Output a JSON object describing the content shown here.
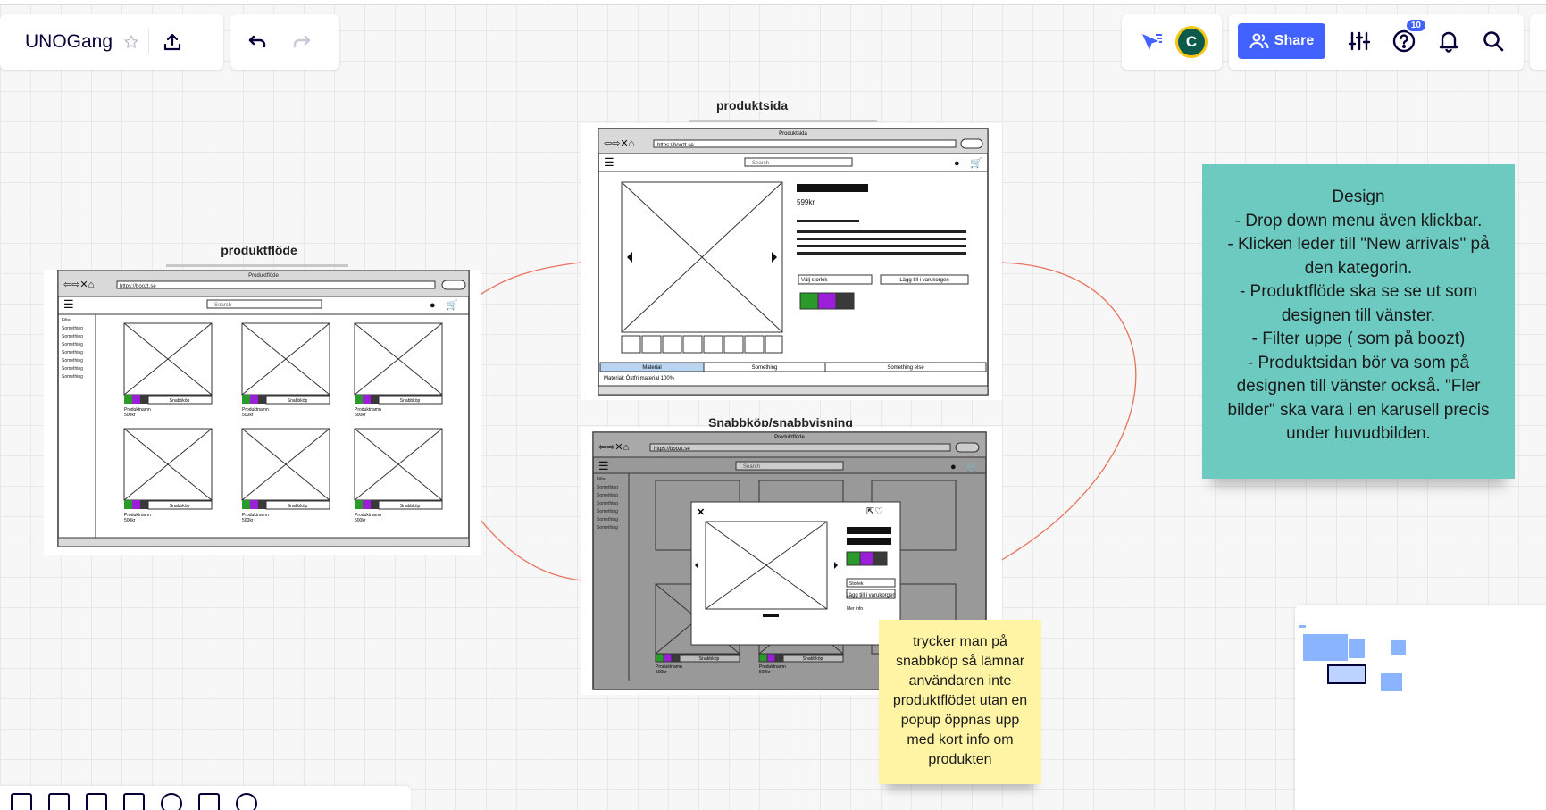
{
  "board": {
    "name": "UNOGang"
  },
  "toolbar": {
    "share_label": "Share",
    "avatar_initial": "C",
    "help_badge": "10"
  },
  "frames": {
    "produktflode": {
      "title": "produktflöde",
      "window_title": "Produktflöde",
      "url": "https://boozt.se",
      "search_placeholder": "Search",
      "sidebar": [
        "Filter",
        "Something",
        "Something",
        "Something",
        "Something",
        "Something",
        "Something",
        "Something"
      ],
      "product_button": "Snabbköp",
      "product_name": "Produktnamn",
      "product_price": "500kr"
    },
    "produktsida": {
      "title": "produktsida",
      "window_title": "Produktsida",
      "url": "https://boozt.se",
      "search_placeholder": "Search",
      "price": "599kr",
      "size_select": "Välj storlek",
      "add_to_cart": "Lägg till i varukorgen",
      "tabs": [
        "Material",
        "Something",
        "Something else"
      ],
      "material_text": "Material: Östfri material 100%"
    },
    "snabbkop": {
      "title": "Snabbköp/snabbvisning",
      "window_title": "Produktflöde",
      "url": "https://boozt.se",
      "search_placeholder": "Search",
      "sidebar": [
        "Filter",
        "Something",
        "Something",
        "Something",
        "Something",
        "Something",
        "Something"
      ],
      "popup_size_select": "Storlek",
      "popup_add_to_cart": "Lägg till i varukorgen",
      "popup_more_info": "Mer info",
      "product_button": "Snabbköp",
      "product_name": "Produktnamn",
      "product_price": "500kr"
    }
  },
  "stickies": {
    "design": "Design\n- Drop down menu även klickbar.\n- Klicken leder till \"New arrivals\" på den kategorin.\n- Produktflöde ska se se ut som designen till vänster.\n- Filter uppe ( som på boozt)\n- Produktsidan bör va som på designen till vänster också. \"Fler bilder\" ska vara i en karusell precis under huvudbilden.",
    "snabbkop_note": "trycker man på snabbköp så lämnar användaren inte produktflödet utan en popup öppnas upp med kort info om produkten"
  },
  "colors": {
    "accent": "#4262ff",
    "sticky_teal": "#6ccac0",
    "sticky_yellow": "#fef4a4",
    "connector": "#e8735c",
    "swatch_green": "#2a9a2a",
    "swatch_purple": "#9b1fd8",
    "swatch_dark": "#3a3a3a"
  },
  "icons": [
    "star-icon",
    "upload-icon",
    "undo-icon",
    "redo-icon",
    "cursor-icon",
    "share-people-icon",
    "settings-icon",
    "help-icon",
    "bell-icon",
    "search-icon"
  ]
}
